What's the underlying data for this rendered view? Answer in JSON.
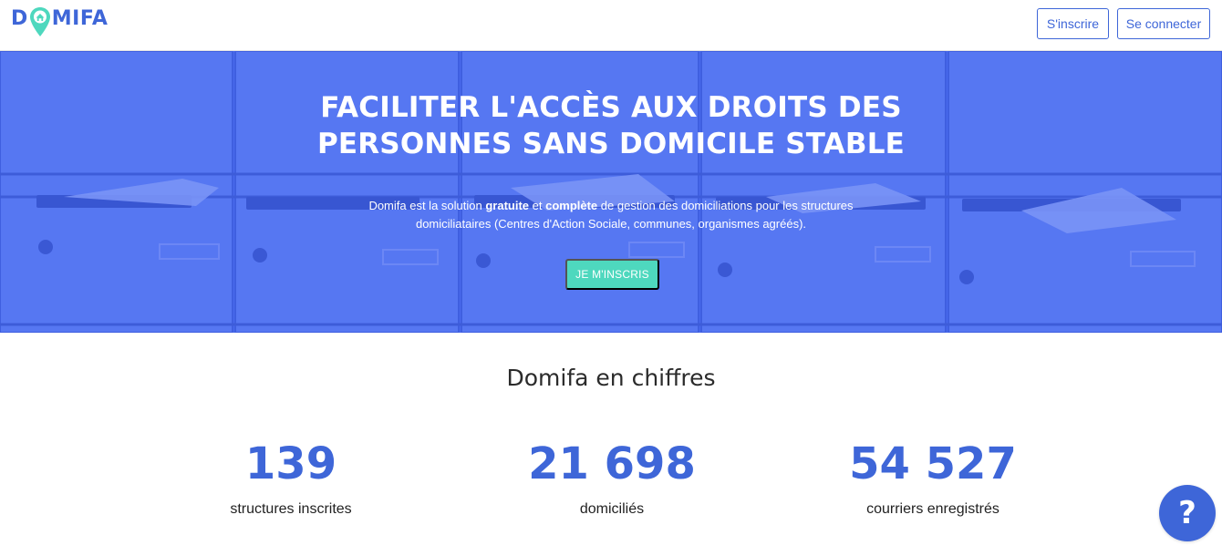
{
  "colors": {
    "brand_blue": "#3e66d8",
    "hero_overlay": "#4a6bef",
    "cta_green": "#4ed8be",
    "pin_green": "#4ed8be"
  },
  "header": {
    "logo": {
      "prefix": "D",
      "suffix": "MIFA",
      "icon": "location-pin-house-icon"
    },
    "signup_label": "S'inscrire",
    "login_label": "Se connecter"
  },
  "hero": {
    "title_line1": "FACILITER L'ACCÈS AUX DROITS DES",
    "title_line2": "PERSONNES SANS DOMICILE STABLE",
    "description": {
      "part1": "Domifa est la solution ",
      "bold1": "gratuite",
      "part2": " et ",
      "bold2": "complète",
      "part3": " de gestion des domiciliations pour les structures domiciliataires (Centres d'Action Sociale, communes, organismes agréés)."
    },
    "cta_label": "JE M'INSCRIS"
  },
  "stats": {
    "title": "Domifa en chiffres",
    "items": [
      {
        "value": "139",
        "label": "structures inscrites"
      },
      {
        "value": "21 698",
        "label": "domiciliés"
      },
      {
        "value": "54 527",
        "label": "courriers enregistrés"
      }
    ]
  },
  "help": {
    "label": "?",
    "icon": "question-mark-icon"
  }
}
